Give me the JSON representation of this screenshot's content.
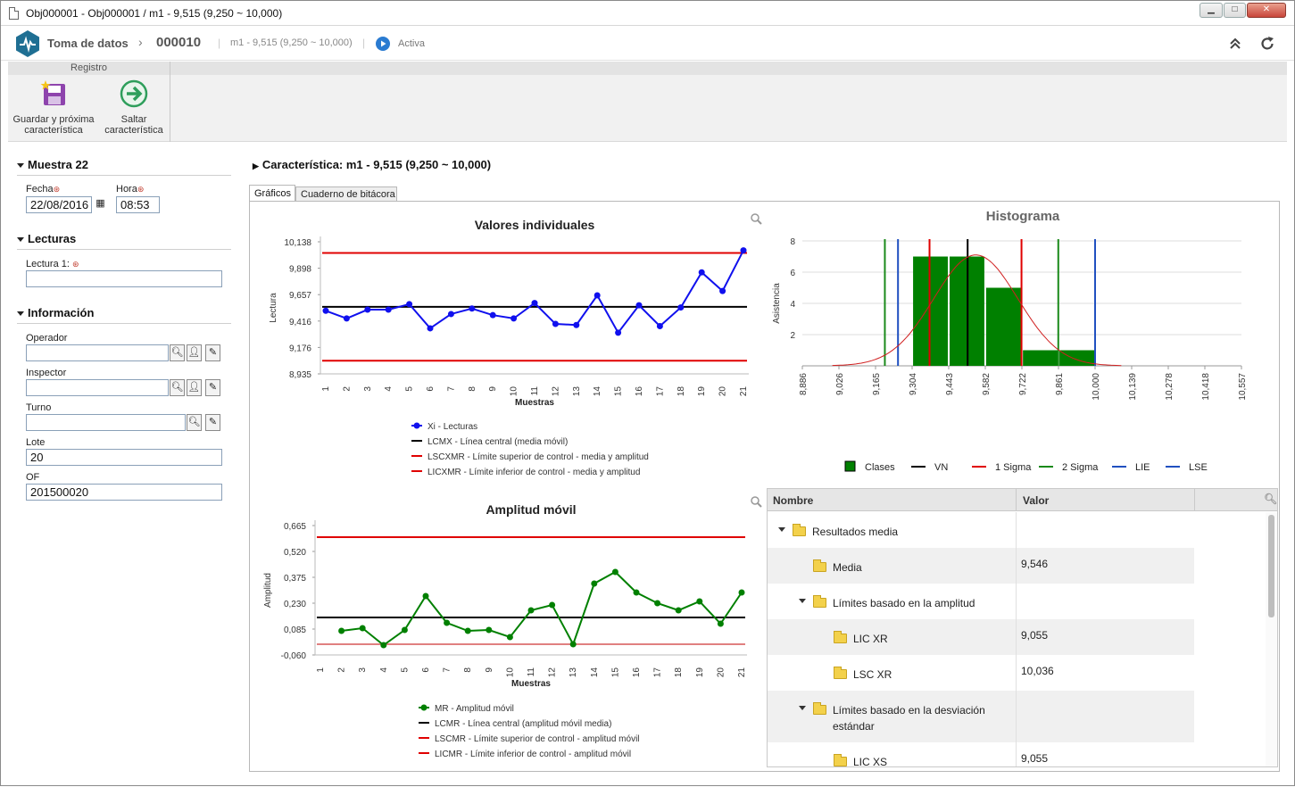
{
  "window": {
    "title": "Obj000001 - Obj000001 / m1 - 9,515 (9,250 ~ 10,000)"
  },
  "header": {
    "app": "Toma de datos",
    "sep": "›",
    "code": "000010",
    "char": "m1 - 9,515 (9,250 ~ 10,000)",
    "pipe": "|",
    "status": "Activa"
  },
  "ribbon": {
    "group": "Registro",
    "save_next": [
      "Guardar y próxima",
      "característica"
    ],
    "skip": [
      "Saltar",
      "característica"
    ]
  },
  "left": {
    "sample_title": "Muestra 22",
    "date_label": "Fecha",
    "date_value": "22/08/2016",
    "time_label": "Hora",
    "time_value": "08:53",
    "readings_title": "Lecturas",
    "reading1_label": "Lectura 1:",
    "reading1_value": "",
    "info_title": "Información",
    "operator_label": "Operador",
    "inspector_label": "Inspector",
    "shift_label": "Turno",
    "lot_label": "Lote",
    "lot_value": "20",
    "of_label": "OF",
    "of_value": "201500020"
  },
  "main": {
    "char_title": "Característica: m1 - 9,515 (9,250 ~ 10,000)",
    "tabs": [
      "Gráficos",
      "Cuaderno de bitácora"
    ]
  },
  "colors": {
    "accent": "#1e4f8a",
    "individual": "#1010ee",
    "range": "#008000",
    "center": "#000000",
    "limit": "#e00000"
  },
  "chart_data": [
    {
      "type": "line",
      "title": "Valores individuales",
      "xlabel": "Muestras",
      "ylabel": "Lectura",
      "yticks": [
        "10,138",
        "9,898",
        "9,657",
        "9,416",
        "9,176",
        "8,935"
      ],
      "ylim": [
        8.935,
        10.138
      ],
      "x": [
        "1",
        "2",
        "3",
        "4",
        "5",
        "6",
        "7",
        "8",
        "9",
        "10",
        "11",
        "12",
        "13",
        "14",
        "15",
        "16",
        "17",
        "18",
        "19",
        "20",
        "21"
      ],
      "series": [
        {
          "name": "Xi - Lecturas",
          "values": [
            9.51,
            9.44,
            9.52,
            9.52,
            9.57,
            9.35,
            9.48,
            9.53,
            9.47,
            9.44,
            9.58,
            9.39,
            9.38,
            9.65,
            9.31,
            9.56,
            9.37,
            9.54,
            9.86,
            9.69,
            10.06
          ]
        },
        {
          "name": "LCMX - Línea central (media móvil)",
          "value": 9.546
        },
        {
          "name": "LSCXMR - Límite superior de control - media y amplitud",
          "value": 10.036
        },
        {
          "name": "LICXMR - Límite inferior de control - media y amplitud",
          "value": 9.055
        }
      ]
    },
    {
      "type": "line",
      "title": "Amplitud móvil",
      "xlabel": "Muestras",
      "ylabel": "Amplitud",
      "yticks": [
        "0,665",
        "0,520",
        "0,375",
        "0,230",
        "0,085",
        "-0,060"
      ],
      "ylim": [
        -0.06,
        0.665
      ],
      "x": [
        "1",
        "2",
        "3",
        "4",
        "5",
        "6",
        "7",
        "8",
        "9",
        "10",
        "11",
        "12",
        "13",
        "14",
        "15",
        "16",
        "17",
        "18",
        "19",
        "20",
        "21"
      ],
      "series": [
        {
          "name": "MR - Amplitud móvil",
          "values": [
            null,
            0.075,
            0.09,
            -0.005,
            0.08,
            0.27,
            0.12,
            0.075,
            0.08,
            0.04,
            0.19,
            0.22,
            0.0,
            0.34,
            0.405,
            0.29,
            0.23,
            0.19,
            0.24,
            0.115,
            0.29
          ]
        },
        {
          "name": "LCMR - Línea central (amplitud móvil media)",
          "value": 0.15
        },
        {
          "name": "LSCMR - Límite superior de control - amplitud móvil",
          "value": 0.6
        },
        {
          "name": "LICMR - Límite inferior de control - amplitud móvil",
          "value": 0.0
        }
      ]
    },
    {
      "type": "bar",
      "title": "Histograma",
      "ylabel": "Asistencia",
      "xticks": [
        "8,886",
        "9,026",
        "9,165",
        "9,304",
        "9,443",
        "9,582",
        "9,722",
        "9,861",
        "10,000",
        "10,139",
        "10,278",
        "10,418",
        "10,557"
      ],
      "yticks": [
        "8",
        "6",
        "4",
        "2"
      ],
      "ylim": [
        0,
        8
      ],
      "bins": [
        [
          9.304,
          9.443,
          7
        ],
        [
          9.443,
          9.582,
          7
        ],
        [
          9.582,
          9.722,
          5
        ],
        [
          9.722,
          9.861,
          1
        ],
        [
          9.861,
          10.0,
          1
        ]
      ],
      "lines": {
        "VN": [
          9.515
        ],
        "1 Sigma": [
          9.37,
          9.72
        ],
        "2 Sigma": [
          9.2,
          9.86
        ],
        "LIE": [
          9.25
        ],
        "LSE": [
          10.0
        ]
      },
      "legend": [
        "Clases",
        "VN",
        "1 Sigma",
        "2 Sigma",
        "LIE",
        "LSE"
      ]
    }
  ],
  "table": {
    "columns": [
      "Nombre",
      "Valor"
    ],
    "rows": [
      {
        "name": "Resultados media",
        "value": ""
      },
      {
        "name": "Media",
        "value": "9,546"
      },
      {
        "name": "Límites basado en la amplitud",
        "value": ""
      },
      {
        "name": "LIC XR",
        "value": "9,055"
      },
      {
        "name": "LSC XR",
        "value": "10,036"
      },
      {
        "name": "Límites basado en la desviación",
        "name2": "estándar",
        "value": ""
      },
      {
        "name": "LIC XS",
        "value": "9,055"
      }
    ]
  }
}
